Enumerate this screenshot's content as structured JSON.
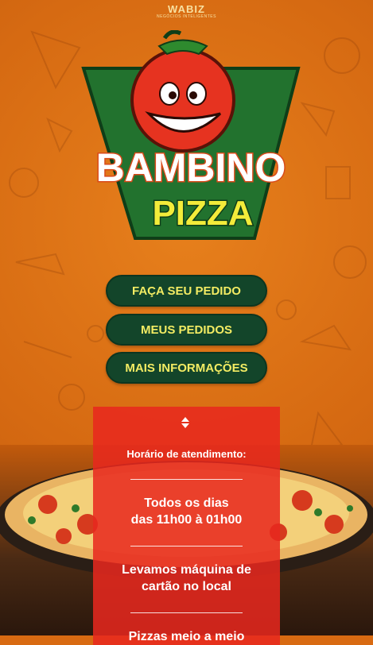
{
  "header": {
    "brand": "WABIZ",
    "tagline": "NEGÓCIOS INTELIGENTES"
  },
  "logo": {
    "line1": "BAMBINO",
    "line2": "PIZZA"
  },
  "menu": {
    "order": "FAÇA SEU PEDIDO",
    "my_orders": "MEUS PEDIDOS",
    "more_info": "MAIS INFORMAÇÕES"
  },
  "info": {
    "hours_title": "Horário de atendimento:",
    "hours_line1": "Todos os dias",
    "hours_line2": "das 11h00 à 01h00",
    "card_line1": "Levamos máquina de",
    "card_line2": "cartão no local",
    "extra_line1": "Pizzas meio a meio"
  },
  "colors": {
    "background": "#d86a12",
    "button_bg": "#13452a",
    "button_text": "#f3ec63",
    "panel_bg": "#e8281e"
  }
}
